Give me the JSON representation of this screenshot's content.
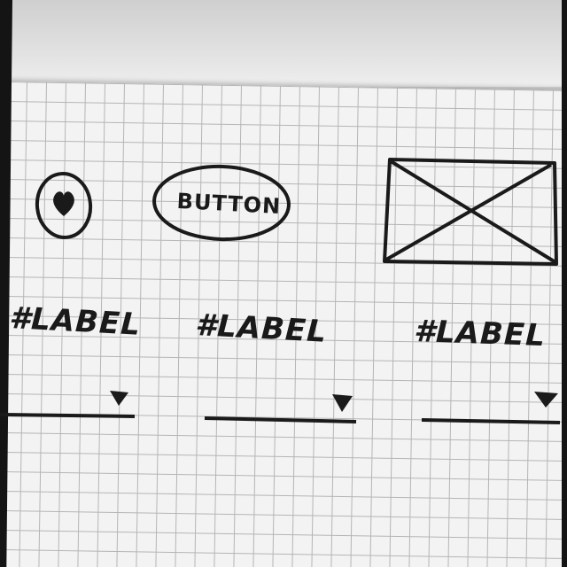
{
  "widgets": {
    "icon_button": {
      "icon": "heart-icon"
    },
    "button": {
      "label": "BUTTON"
    },
    "image_placeholder": {
      "icon": "image-placeholder-icon"
    },
    "labels": [
      "#LABEL",
      "#LABEL",
      "#LABEL"
    ],
    "dropdowns": [
      {
        "icon": "caret-down-icon"
      },
      {
        "icon": "caret-down-icon"
      },
      {
        "icon": "caret-down-icon"
      }
    ]
  },
  "colors": {
    "ink": "#1a1a1a",
    "paper": "#f3f3f3",
    "grid": "#b5b5b5"
  }
}
